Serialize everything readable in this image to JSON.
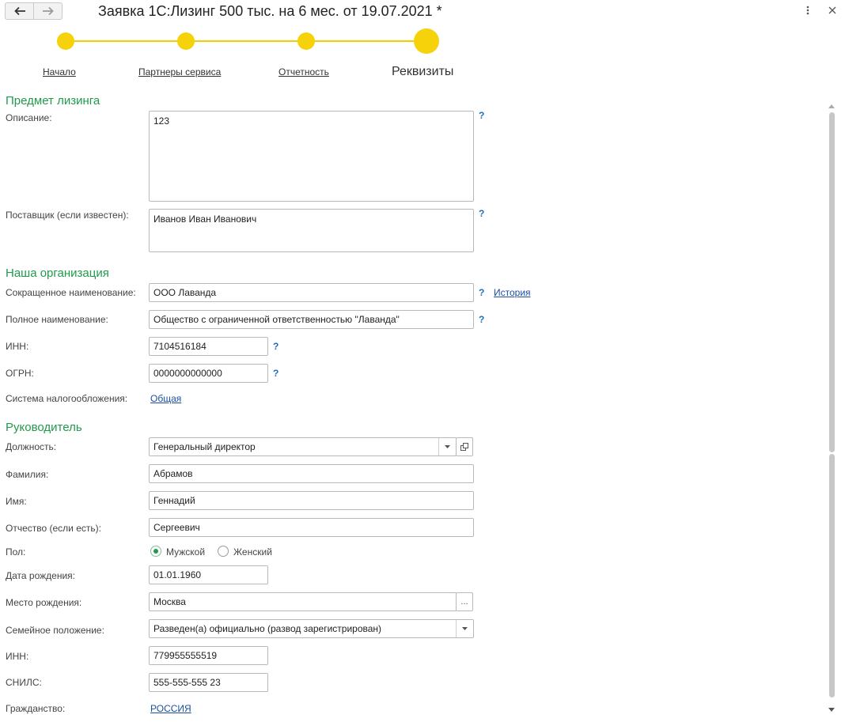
{
  "window": {
    "title": "Заявка 1С:Лизинг 500 тыс. на 6 мес. от 19.07.2021 *",
    "icons": {
      "back": "arrow-left-icon",
      "forward": "arrow-right-icon",
      "more": "more-vertical-icon",
      "close": "close-icon"
    }
  },
  "steps": [
    {
      "label": "Начало",
      "state": "done"
    },
    {
      "label": "Партнеры сервиса",
      "state": "done"
    },
    {
      "label": "Отчетность",
      "state": "done"
    },
    {
      "label": "Реквизиты",
      "state": "current"
    }
  ],
  "colors": {
    "accent_yellow": "#f5d20a",
    "section_green": "#219a4b",
    "link_blue": "#1c4fa0",
    "help_blue": "#1f6fb7"
  },
  "leasing": {
    "heading": "Предмет лизинга",
    "description_label": "Описание:",
    "description_value": "123",
    "supplier_label": "Поставщик (если известен):",
    "supplier_value": "Иванов Иван Иванович"
  },
  "organization": {
    "heading": "Наша организация",
    "short_name_label": "Сокращенное наименование:",
    "short_name_value": "ООО Лаванда",
    "history_link": "История",
    "full_name_label": "Полное наименование:",
    "full_name_value": "Общество с ограниченной ответственностью \"Лаванда\"",
    "inn_label": "ИНН:",
    "inn_value": "7104516184",
    "ogrn_label": "ОГРН:",
    "ogrn_value": "0000000000000",
    "tax_label": "Система налогообложения:",
    "tax_value": "Общая"
  },
  "help_mark": "?",
  "head": {
    "heading": "Руководитель",
    "position_label": "Должность:",
    "position_value": "Генеральный директор",
    "lastname_label": "Фамилия:",
    "lastname_value": "Абрамов",
    "firstname_label": "Имя:",
    "firstname_value": "Геннадий",
    "middlename_label": "Отчество (если есть):",
    "middlename_value": "Сергеевич",
    "gender_label": "Пол:",
    "gender_options": [
      "Мужской",
      "Женский"
    ],
    "gender_selected": "Мужской",
    "birthdate_label": "Дата рождения:",
    "birthdate_value": "01.01.1960",
    "birthplace_label": "Место рождения:",
    "birthplace_value": "Москва",
    "birthplace_button": "...",
    "marital_label": "Семейное положение:",
    "marital_value": "Разведен(а) официально (развод зарегистрирован)",
    "inn_label": "ИНН:",
    "inn_value": "779955555519",
    "snils_label": "СНИЛС:",
    "snils_value": "555-555-555 23",
    "citizenship_label": "Гражданство:",
    "citizenship_value": "РОССИЯ"
  }
}
